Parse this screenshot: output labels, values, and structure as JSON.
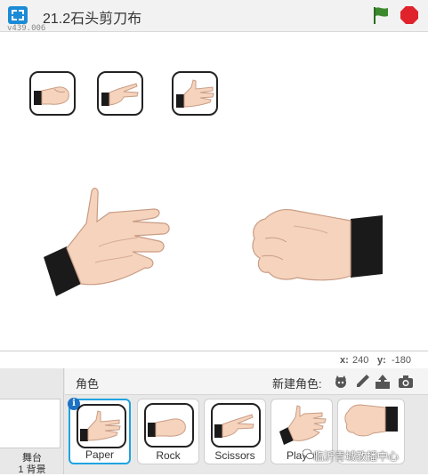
{
  "header": {
    "title": "21.2石头剪刀布",
    "version": "v439.006"
  },
  "coords": {
    "x_label": "x:",
    "x_value": "240",
    "y_label": "y:",
    "y_value": "-180"
  },
  "stage_panel": {
    "label": "舞台",
    "backdrops": "1 背景"
  },
  "sprites": {
    "title": "角色",
    "new_sprite_label": "新建角色:",
    "items": [
      {
        "name": "Paper",
        "selected": true
      },
      {
        "name": "Rock",
        "selected": false
      },
      {
        "name": "Scissors",
        "selected": false
      },
      {
        "name": "Player",
        "selected": false
      },
      {
        "name": "",
        "selected": false
      }
    ]
  },
  "watermark": "临沂青城教播中心",
  "colors": {
    "accent": "#1fa3e0",
    "flag": "#3d8a2e",
    "stop": "#e0232a",
    "sleeve": "#1a1a1a",
    "skin": "#f5d3bd"
  }
}
